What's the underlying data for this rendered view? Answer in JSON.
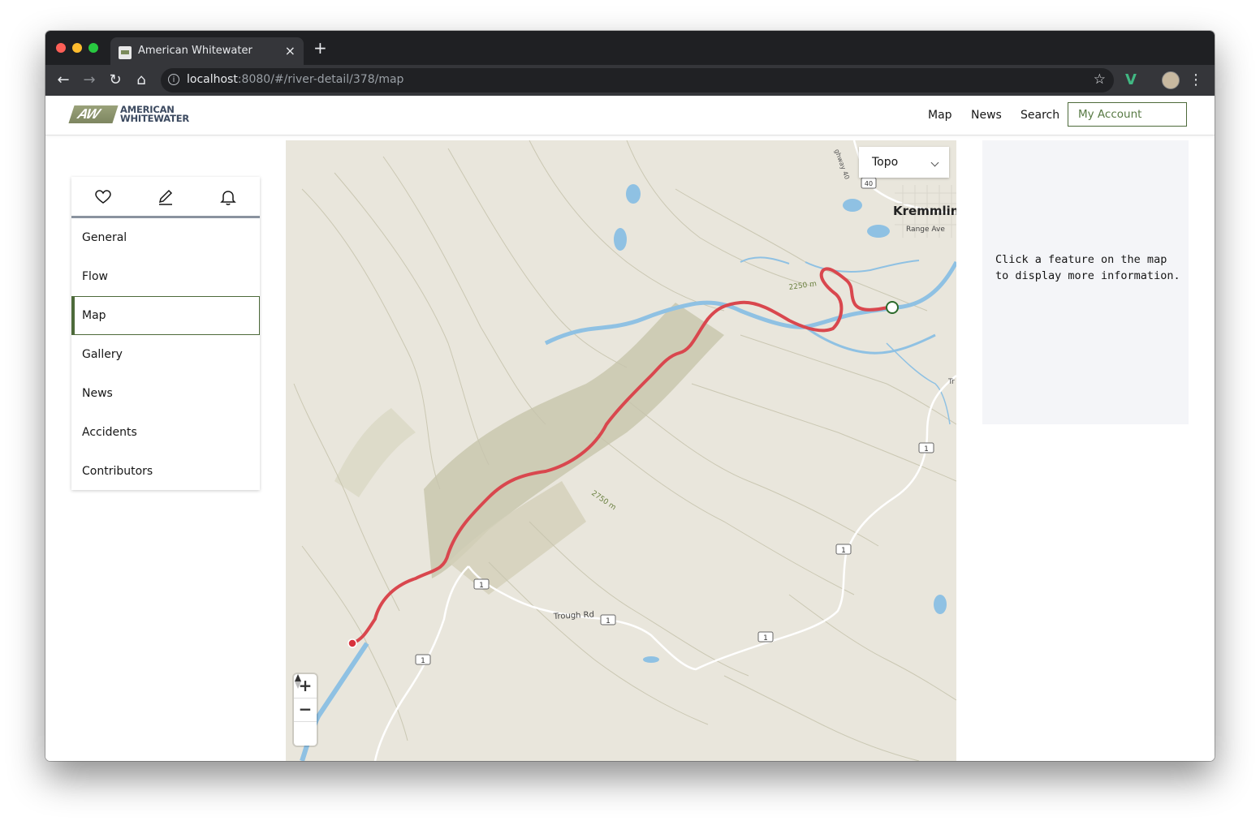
{
  "browser": {
    "tab_title": "American Whitewater",
    "tab_close": "×",
    "new_tab": "+",
    "url_host": "localhost",
    "url_rest": ":8080/#/river-detail/378/map",
    "back": "←",
    "forward": "→",
    "reload": "↻",
    "home": "⌂",
    "bookmark": "☆",
    "extension": "V",
    "menu": "⋮"
  },
  "header": {
    "logo_mark": "AW",
    "logo_line1": "AMERICAN",
    "logo_line2": "WHITEWATER",
    "nav": [
      "Map",
      "News",
      "Search"
    ],
    "account_label": "My Account"
  },
  "sidenav": {
    "icons": [
      "heart-icon",
      "pencil-icon",
      "bell-icon"
    ],
    "items": [
      {
        "label": "General",
        "active": false
      },
      {
        "label": "Flow",
        "active": false
      },
      {
        "label": "Map",
        "active": true
      },
      {
        "label": "Gallery",
        "active": false
      },
      {
        "label": "News",
        "active": false
      },
      {
        "label": "Accidents",
        "active": false
      },
      {
        "label": "Contributors",
        "active": false
      }
    ]
  },
  "map": {
    "layer": "Topo",
    "labels": {
      "town": "Kremmling",
      "street": "Range Ave",
      "road": "Trough Rd",
      "contour1": "2250 m",
      "contour2": "2750 m",
      "hwy40": "40",
      "route1": "1",
      "highway": "ghway 40",
      "truncated": "Tr"
    },
    "zoom_in": "+",
    "zoom_out": "−",
    "colors": {
      "river_run": "#d9474e",
      "water": "#8fc1e3",
      "terrain": "#e9e6dc",
      "contour": "#c7c4ae",
      "put_in_marker": "#d7323c",
      "take_out_marker": "#2b6a2b"
    }
  },
  "info": {
    "message": "Click a feature on the map to display more information."
  }
}
